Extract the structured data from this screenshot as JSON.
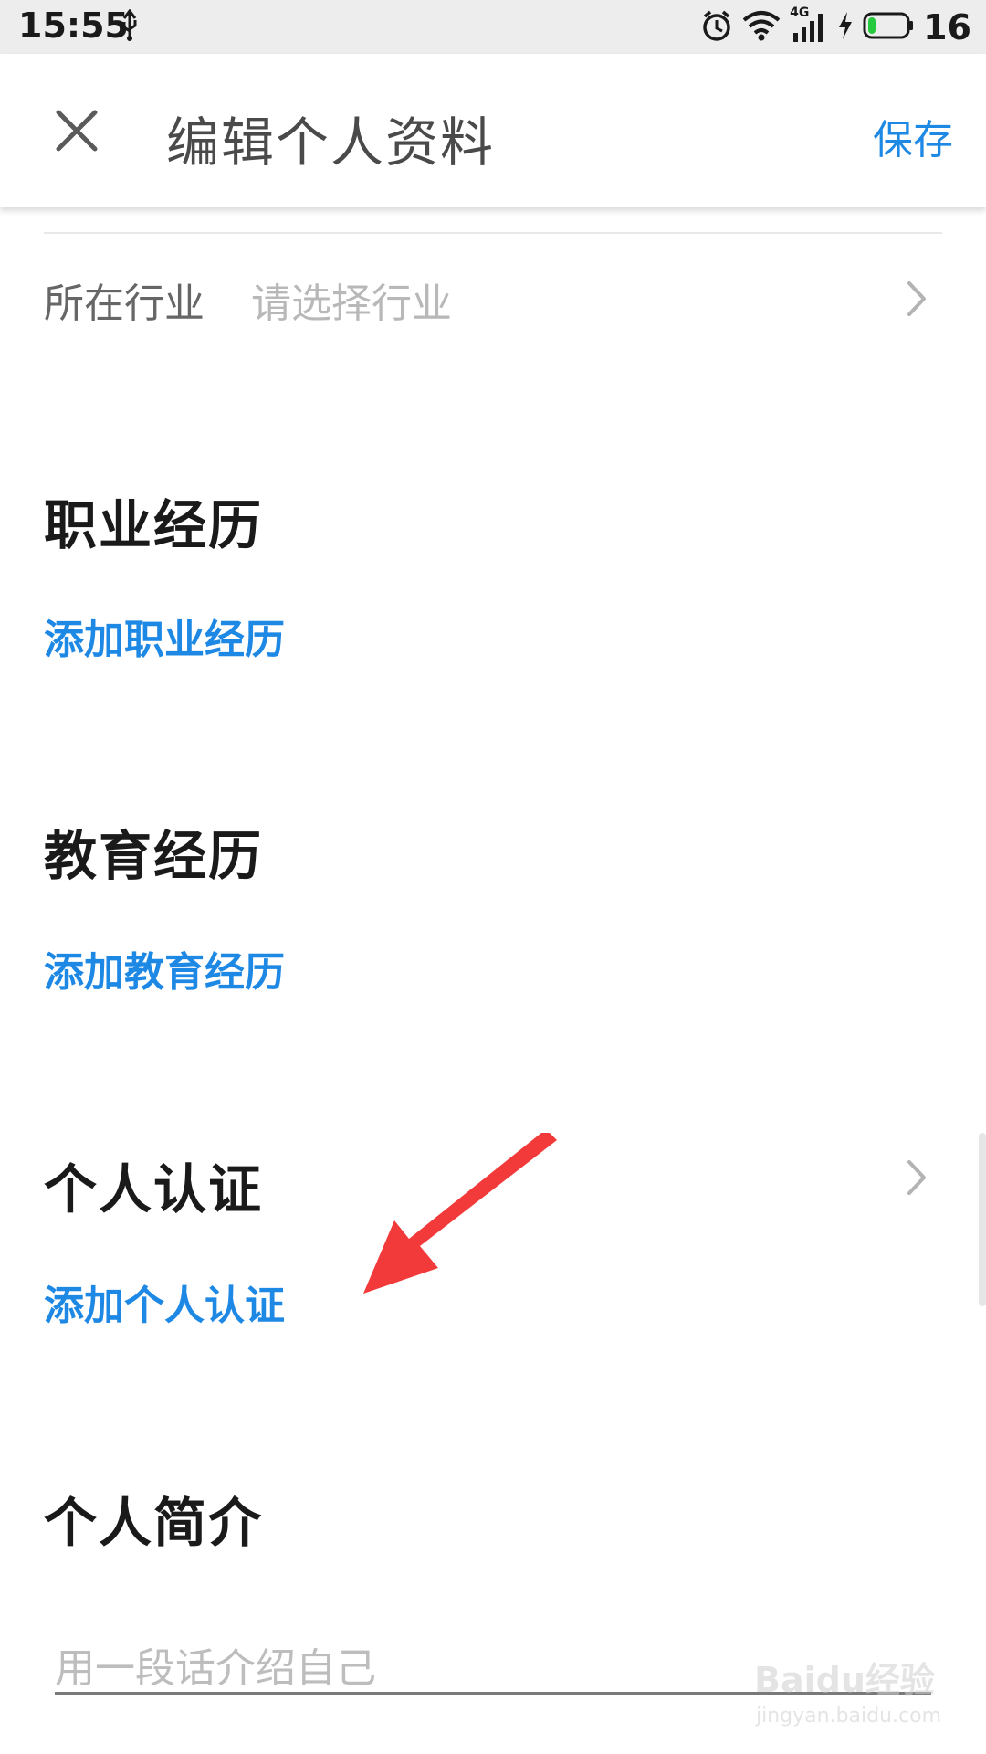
{
  "status_bar": {
    "time": "15:55",
    "network": "4G",
    "battery": "16"
  },
  "app_bar": {
    "title": "编辑个人资料",
    "save_label": "保存"
  },
  "industry": {
    "label": "所在行业",
    "placeholder": "请选择行业"
  },
  "sections": {
    "career": {
      "title": "职业经历",
      "add_label": "添加职业经历"
    },
    "education": {
      "title": "教育经历",
      "add_label": "添加教育经历"
    },
    "certification": {
      "title": "个人认证",
      "add_label": "添加个人认证"
    },
    "intro": {
      "title": "个人简介",
      "placeholder": "用一段话介绍自己"
    }
  },
  "watermark": {
    "brand": "Baidu经验",
    "url": "jingyan.baidu.com"
  },
  "colors": {
    "accent": "#1e88e5",
    "annotation": "#f23a3a"
  }
}
